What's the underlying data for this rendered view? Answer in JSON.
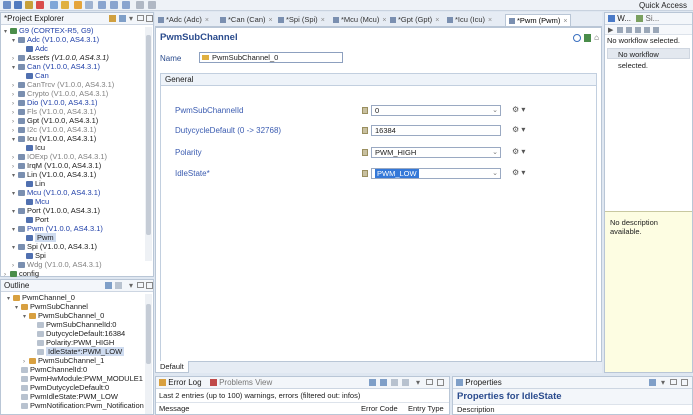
{
  "toolbar": {
    "quick_access": "Quick Access"
  },
  "project_explorer": {
    "title": "*Project Explorer",
    "rows": [
      {
        "label": "G9 (CORTEX-R5, G9)",
        "style": "blue",
        "depth": 0,
        "arrow": "▾"
      },
      {
        "label": "Adc (V1.0.0, AS4.3.1)",
        "style": "blue",
        "depth": 1,
        "arrow": "▾"
      },
      {
        "label": "Adc",
        "style": "blue",
        "depth": 2,
        "arrow": ""
      },
      {
        "label": "Assets (V1.0.0, AS4.3.1)",
        "style": "italic",
        "depth": 1,
        "arrow": "›"
      },
      {
        "label": "Can (V1.0.0, AS4.3.1)",
        "style": "blue",
        "depth": 1,
        "arrow": "▾"
      },
      {
        "label": "Can",
        "style": "blue",
        "depth": 2,
        "arrow": ""
      },
      {
        "label": "CanTrcv (V1.0.0, AS4.3.1)",
        "style": "gray",
        "depth": 1,
        "arrow": "›"
      },
      {
        "label": "Crypto (V1.0.0, AS4.3.1)",
        "style": "gray",
        "depth": 1,
        "arrow": "›"
      },
      {
        "label": "Dio (V1.0.0, AS4.3.1)",
        "style": "blue",
        "depth": 1,
        "arrow": "›"
      },
      {
        "label": "Fls (V1.0.0, AS4.3.1)",
        "style": "gray",
        "depth": 1,
        "arrow": "›"
      },
      {
        "label": "Gpt (V1.0.0, AS4.3.1)",
        "style": "normal",
        "depth": 1,
        "arrow": "›"
      },
      {
        "label": "I2c (V1.0.0, AS4.3.1)",
        "style": "gray",
        "depth": 1,
        "arrow": "›"
      },
      {
        "label": "Icu (V1.0.0, AS4.3.1)",
        "style": "normal",
        "depth": 1,
        "arrow": "▾"
      },
      {
        "label": "Icu",
        "style": "normal",
        "depth": 2,
        "arrow": ""
      },
      {
        "label": "IOExp (V1.0.0, AS4.3.1)",
        "style": "gray",
        "depth": 1,
        "arrow": "›"
      },
      {
        "label": "IrqM (V1.0.0, AS4.3.1)",
        "style": "normal",
        "depth": 1,
        "arrow": "›"
      },
      {
        "label": "Lin (V1.0.0, AS4.3.1)",
        "style": "normal",
        "depth": 1,
        "arrow": "▾"
      },
      {
        "label": "Lin",
        "style": "normal",
        "depth": 2,
        "arrow": ""
      },
      {
        "label": "Mcu (V1.0.0, AS4.3.1)",
        "style": "blue",
        "depth": 1,
        "arrow": "▾"
      },
      {
        "label": "Mcu",
        "style": "blue",
        "depth": 2,
        "arrow": ""
      },
      {
        "label": "Port (V1.0.0, AS4.3.1)",
        "style": "normal",
        "depth": 1,
        "arrow": "▾"
      },
      {
        "label": "Port",
        "style": "normal",
        "depth": 2,
        "arrow": ""
      },
      {
        "label": "Pwm (V1.0.0, AS4.3.1)",
        "style": "blue",
        "depth": 1,
        "arrow": "▾"
      },
      {
        "label": "Pwm",
        "style": "selected",
        "depth": 2,
        "arrow": ""
      },
      {
        "label": "Spi (V1.0.0, AS4.3.1)",
        "style": "normal",
        "depth": 1,
        "arrow": "▾"
      },
      {
        "label": "Spi",
        "style": "normal",
        "depth": 2,
        "arrow": ""
      },
      {
        "label": "Wdg (V1.0.0, AS4.3.1)",
        "style": "gray",
        "depth": 1,
        "arrow": "›"
      },
      {
        "label": "config",
        "style": "normal",
        "depth": 0,
        "arrow": "›"
      }
    ]
  },
  "outline": {
    "title": "Outline",
    "rows": [
      {
        "label": "PwmChannel_0",
        "depth": 0,
        "arrow": "▾"
      },
      {
        "label": "PwmSubChannel",
        "depth": 1,
        "arrow": "▾"
      },
      {
        "label": "PwmSubChannel_0",
        "depth": 2,
        "arrow": "▾"
      },
      {
        "label": "PwmSubChannelId:0",
        "depth": 3,
        "arrow": ""
      },
      {
        "label": "DutycycleDefault:16384",
        "depth": 3,
        "arrow": ""
      },
      {
        "label": "Polarity:PWM_HIGH",
        "depth": 3,
        "arrow": ""
      },
      {
        "label": "IdleState*:PWM_LOW",
        "depth": 3,
        "arrow": "",
        "selected": true
      },
      {
        "label": "PwmSubChannel_1",
        "depth": 2,
        "arrow": "›"
      },
      {
        "label": "PwmChannelId:0",
        "depth": 1,
        "arrow": ""
      },
      {
        "label": "PwmHwModule:PWM_MODULE1",
        "depth": 1,
        "arrow": ""
      },
      {
        "label": "PwmDutycycleDefault:0",
        "depth": 1,
        "arrow": ""
      },
      {
        "label": "PwmIdleState:PWM_LOW",
        "depth": 1,
        "arrow": ""
      },
      {
        "label": "PwmNotification:Pwm_Notification",
        "depth": 1,
        "arrow": ""
      }
    ]
  },
  "editor_tabs": [
    "*Adc (Adc)",
    "*Can (Can)",
    "*Spi (Spi)",
    "*Mcu (Mcu)",
    "*Gpt (Gpt)",
    "*Icu (Icu)",
    "*Pwm (Pwm)"
  ],
  "editor": {
    "title": "PwmSubChannel",
    "name_label": "Name",
    "name_value": "PwmSubChannel_0",
    "section": "General",
    "params": [
      {
        "label": "PwmSubChannelId",
        "value": "0",
        "dropdown": true
      },
      {
        "label": "DutycycleDefault (0 -> 32768)",
        "value": "16384",
        "dropdown": false
      },
      {
        "label": "Polarity",
        "value": "PWM_HIGH",
        "dropdown": true
      },
      {
        "label": "IdleState*",
        "value": "PWM_LOW",
        "dropdown": true,
        "highlight": true
      }
    ],
    "bottom_tab": "Default"
  },
  "workflow": {
    "tab1": "W...",
    "tab2": "Si...",
    "no_workflow": "No workflow selected.",
    "no_workflow_bar": "No workflow selected.",
    "description": "No description available."
  },
  "error_log": {
    "tab1": "Error Log",
    "tab2": "Problems View",
    "summary": "Last 2 entries (up to 100) warnings, errors (filtered out: infos)",
    "col1": "Message",
    "col2": "Error Code",
    "col3": "Entry Type"
  },
  "properties": {
    "tab": "Properties",
    "title": "Properties for IdleState",
    "col": "Description"
  }
}
